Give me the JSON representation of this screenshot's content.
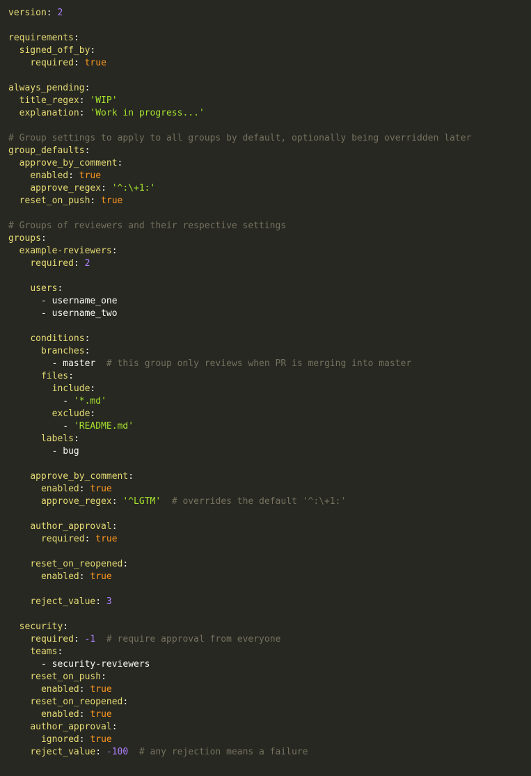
{
  "file": {
    "lines": [
      {
        "indent": "",
        "key": "version",
        "value": "2",
        "vtype": "n"
      },
      {
        "blank": true
      },
      {
        "indent": "",
        "key": "requirements"
      },
      {
        "indent": "  ",
        "key": "signed_off_by"
      },
      {
        "indent": "    ",
        "key": "required",
        "value": "true",
        "vtype": "b"
      },
      {
        "blank": true
      },
      {
        "indent": "",
        "key": "always_pending"
      },
      {
        "indent": "  ",
        "key": "title_regex",
        "value": "'WIP'",
        "vtype": "s"
      },
      {
        "indent": "  ",
        "key": "explanation",
        "value": "'Work in progress...'",
        "vtype": "s"
      },
      {
        "blank": true
      },
      {
        "indent": "",
        "comment": "# Group settings to apply to all groups by default, optionally being overridden later"
      },
      {
        "indent": "",
        "key": "group_defaults"
      },
      {
        "indent": "  ",
        "key": "approve_by_comment"
      },
      {
        "indent": "    ",
        "key": "enabled",
        "value": "true",
        "vtype": "b"
      },
      {
        "indent": "    ",
        "key": "approve_regex",
        "value": "'^:\\+1:'",
        "vtype": "s"
      },
      {
        "indent": "  ",
        "key": "reset_on_push",
        "value": "true",
        "vtype": "b"
      },
      {
        "blank": true
      },
      {
        "indent": "",
        "comment": "# Groups of reviewers and their respective settings"
      },
      {
        "indent": "",
        "key": "groups"
      },
      {
        "indent": "  ",
        "key": "example-reviewers"
      },
      {
        "indent": "    ",
        "key": "required",
        "value": "2",
        "vtype": "n"
      },
      {
        "blank": true
      },
      {
        "indent": "    ",
        "key": "users"
      },
      {
        "indent": "      ",
        "item": "username_one"
      },
      {
        "indent": "      ",
        "item": "username_two"
      },
      {
        "blank": true
      },
      {
        "indent": "    ",
        "key": "conditions"
      },
      {
        "indent": "      ",
        "key": "branches"
      },
      {
        "indent": "        ",
        "item": "master",
        "trail": "  # this group only reviews when PR is merging into master"
      },
      {
        "indent": "      ",
        "key": "files"
      },
      {
        "indent": "        ",
        "key": "include"
      },
      {
        "indent": "          ",
        "item": "'*.md'",
        "itype": "s"
      },
      {
        "indent": "        ",
        "key": "exclude"
      },
      {
        "indent": "          ",
        "item": "'README.md'",
        "itype": "s"
      },
      {
        "indent": "      ",
        "key": "labels"
      },
      {
        "indent": "        ",
        "item": "bug"
      },
      {
        "blank": true
      },
      {
        "indent": "    ",
        "key": "approve_by_comment"
      },
      {
        "indent": "      ",
        "key": "enabled",
        "value": "true",
        "vtype": "b"
      },
      {
        "indent": "      ",
        "key": "approve_regex",
        "value": "'^LGTM'",
        "vtype": "s",
        "trail": "  # overrides the default '^:\\+1:'"
      },
      {
        "blank": true
      },
      {
        "indent": "    ",
        "key": "author_approval"
      },
      {
        "indent": "      ",
        "key": "required",
        "value": "true",
        "vtype": "b"
      },
      {
        "blank": true
      },
      {
        "indent": "    ",
        "key": "reset_on_reopened"
      },
      {
        "indent": "      ",
        "key": "enabled",
        "value": "true",
        "vtype": "b"
      },
      {
        "blank": true
      },
      {
        "indent": "    ",
        "key": "reject_value",
        "value": "3",
        "vtype": "n"
      },
      {
        "blank": true
      },
      {
        "indent": "  ",
        "key": "security"
      },
      {
        "indent": "    ",
        "key": "required",
        "value": "-1",
        "vtype": "n",
        "trail": "  # require approval from everyone"
      },
      {
        "indent": "    ",
        "key": "teams"
      },
      {
        "indent": "      ",
        "item": "security-reviewers"
      },
      {
        "indent": "    ",
        "key": "reset_on_push"
      },
      {
        "indent": "      ",
        "key": "enabled",
        "value": "true",
        "vtype": "b"
      },
      {
        "indent": "    ",
        "key": "reset_on_reopened"
      },
      {
        "indent": "      ",
        "key": "enabled",
        "value": "true",
        "vtype": "b"
      },
      {
        "indent": "    ",
        "key": "author_approval"
      },
      {
        "indent": "      ",
        "key": "ignored",
        "value": "true",
        "vtype": "b"
      },
      {
        "indent": "    ",
        "key": "reject_value",
        "value": "-100",
        "vtype": "n",
        "trail": "  # any rejection means a failure"
      }
    ]
  }
}
